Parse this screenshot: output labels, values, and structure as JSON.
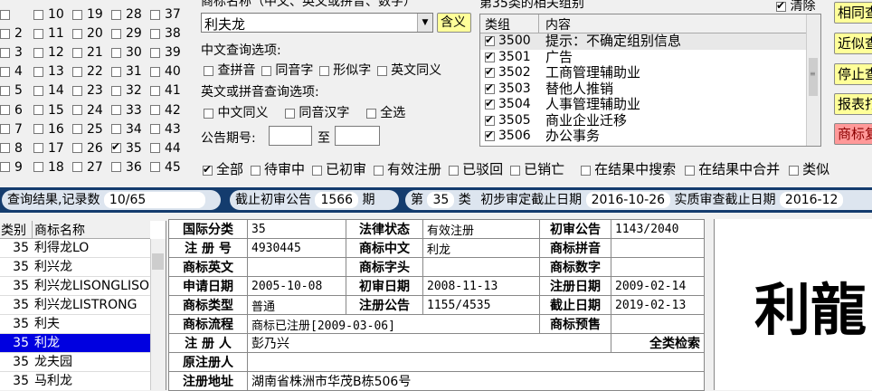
{
  "class_checks": [
    {
      "num": "",
      "checked": false
    },
    {
      "num": "10",
      "checked": false
    },
    {
      "num": "19",
      "checked": false
    },
    {
      "num": "28",
      "checked": false
    },
    {
      "num": "37",
      "checked": false
    },
    {
      "num": "2",
      "checked": false
    },
    {
      "num": "11",
      "checked": false
    },
    {
      "num": "20",
      "checked": false
    },
    {
      "num": "29",
      "checked": false
    },
    {
      "num": "38",
      "checked": false
    },
    {
      "num": "3",
      "checked": false
    },
    {
      "num": "12",
      "checked": false
    },
    {
      "num": "21",
      "checked": false
    },
    {
      "num": "30",
      "checked": false
    },
    {
      "num": "39",
      "checked": false
    },
    {
      "num": "4",
      "checked": false
    },
    {
      "num": "13",
      "checked": false
    },
    {
      "num": "22",
      "checked": false
    },
    {
      "num": "31",
      "checked": false
    },
    {
      "num": "40",
      "checked": false
    },
    {
      "num": "5",
      "checked": false
    },
    {
      "num": "14",
      "checked": false
    },
    {
      "num": "23",
      "checked": false
    },
    {
      "num": "32",
      "checked": false
    },
    {
      "num": "41",
      "checked": false
    },
    {
      "num": "6",
      "checked": false
    },
    {
      "num": "15",
      "checked": false
    },
    {
      "num": "24",
      "checked": false
    },
    {
      "num": "33",
      "checked": false
    },
    {
      "num": "42",
      "checked": false
    },
    {
      "num": "7",
      "checked": false
    },
    {
      "num": "16",
      "checked": false
    },
    {
      "num": "25",
      "checked": false
    },
    {
      "num": "34",
      "checked": false
    },
    {
      "num": "43",
      "checked": false
    },
    {
      "num": "8",
      "checked": false
    },
    {
      "num": "17",
      "checked": false
    },
    {
      "num": "26",
      "checked": false
    },
    {
      "num": "35",
      "checked": true
    },
    {
      "num": "44",
      "checked": false
    },
    {
      "num": "9",
      "checked": false
    },
    {
      "num": "18",
      "checked": false
    },
    {
      "num": "27",
      "checked": false
    },
    {
      "num": "36",
      "checked": false
    },
    {
      "num": "45",
      "checked": false
    }
  ],
  "search": {
    "name_label": "商标名称（中文、英文或拼音、数字）",
    "name_value": "利夫龙",
    "meaning_button": "含义",
    "cn_options_label": "中文查询选项:",
    "cn_options": [
      "查拼音",
      "同音字",
      "形似字",
      "英文同义"
    ],
    "en_options_label": "英文或拼音查询选项:",
    "en_options": [
      "中文同义",
      "同音汉字",
      "全选"
    ],
    "issue_label": "公告期号:",
    "issue_to": "至",
    "issue_from_value": "",
    "issue_to_value": ""
  },
  "groups": {
    "title": "第35类的相关组别",
    "clear_label": "清除",
    "col_group": "类组",
    "col_content": "内容",
    "rows": [
      {
        "code": "3500",
        "text": "提示：不确定组别信息",
        "checked": true
      },
      {
        "code": "3501",
        "text": "广告",
        "checked": true
      },
      {
        "code": "3502",
        "text": "工商管理辅助业",
        "checked": true
      },
      {
        "code": "3503",
        "text": "替他人推销",
        "checked": true
      },
      {
        "code": "3504",
        "text": "人事管理辅助业",
        "checked": true
      },
      {
        "code": "3505",
        "text": "商业企业迁移",
        "checked": true
      },
      {
        "code": "3506",
        "text": "办公事务",
        "checked": true
      }
    ]
  },
  "right_buttons": [
    "相同查",
    "近似查",
    "停止查",
    "报表打",
    "商标复"
  ],
  "status_filters": [
    {
      "label": "全部",
      "checked": true
    },
    {
      "label": "待审中",
      "checked": false
    },
    {
      "label": "已初审",
      "checked": false
    },
    {
      "label": "有效注册",
      "checked": false
    },
    {
      "label": "已驳回",
      "checked": false
    },
    {
      "label": "已销亡",
      "checked": false
    },
    {
      "label": "在结果中搜索",
      "checked": false
    },
    {
      "label": "在结果中合并",
      "checked": false
    },
    {
      "label": "类似",
      "checked": false
    }
  ],
  "infobar": {
    "result_label": "查询结果,记录数",
    "result_value": "10/65",
    "deadline_label": "截止初审公告",
    "deadline_value": "1566",
    "deadline_unit": "期",
    "class_prefix": "第",
    "class_value": "35",
    "class_suffix": "类",
    "prelim_label": "初步审定截止日期",
    "prelim_date": "2016-10-26",
    "substantive_label": "实质审查截止日期",
    "substantive_date": "2016-12"
  },
  "result_list": {
    "col_class": "类别",
    "col_name": "商标名称",
    "rows": [
      {
        "cls": "35",
        "name": "利得龙LO",
        "selected": false
      },
      {
        "cls": "35",
        "name": "利兴龙",
        "selected": false
      },
      {
        "cls": "35",
        "name": "利兴龙LISONGLISO",
        "selected": false
      },
      {
        "cls": "35",
        "name": "利兴龙LISTRONG",
        "selected": false
      },
      {
        "cls": "35",
        "name": "利夫",
        "selected": false
      },
      {
        "cls": "35",
        "name": "利龙",
        "selected": true
      },
      {
        "cls": "35",
        "name": "龙夫园",
        "selected": false
      },
      {
        "cls": "35",
        "name": "马利龙",
        "selected": false
      }
    ]
  },
  "details": {
    "intl_class_label": "国际分类",
    "intl_class": "35",
    "legal_status_label": "法律状态",
    "legal_status": "有效注册",
    "prelim_pub_label": "初审公告",
    "prelim_pub": "1143/2040",
    "reg_no_label": "注 册 号",
    "reg_no": "4930445",
    "name_cn_label": "商标中文",
    "name_cn": "利龙",
    "pinyin_label": "商标拼音",
    "pinyin": "",
    "name_en_label": "商标英文",
    "name_en": "",
    "initials_label": "商标字头",
    "initials": "",
    "digits_label": "商标数字",
    "digits": "",
    "apply_date_label": "申请日期",
    "apply_date": "2005-10-08",
    "prelim_date_label": "初审日期",
    "prelim_date": "2008-11-13",
    "reg_date_label": "注册日期",
    "reg_date": "2009-02-14",
    "type_label": "商标类型",
    "type": "普通",
    "reg_pub_label": "注册公告",
    "reg_pub": "1155/4535",
    "expiry_label": "截止日期",
    "expiry": "2019-02-13",
    "flow_label": "商标流程",
    "flow": "商标已注册[2009-03-06]",
    "warning_label": "商标预售",
    "warning": "",
    "registrant_label": "注 册 人",
    "registrant": "彭乃兴",
    "full_search": "全类检索",
    "orig_registrant_label": "原注册人",
    "orig_registrant": "",
    "address_label": "注册地址",
    "address": "湖南省株洲市华茂B栋506号"
  },
  "preview_text": "利龍"
}
